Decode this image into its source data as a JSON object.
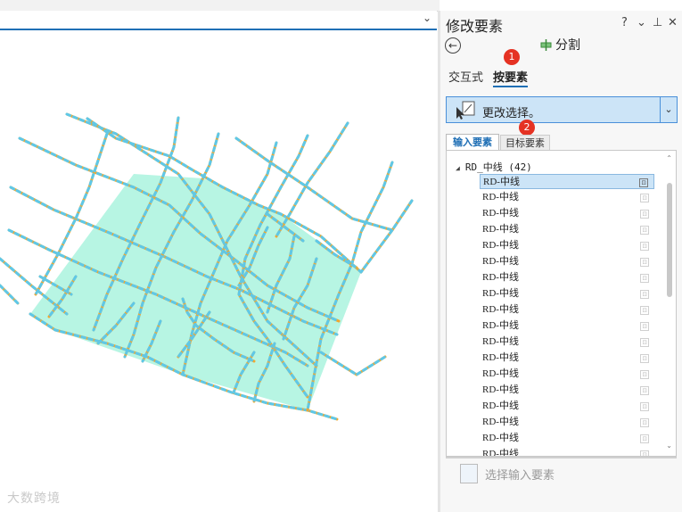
{
  "pane": {
    "title": "修改要素",
    "ctrl_help": "?",
    "ctrl_menu": "⌄",
    "ctrl_pin": "⊥",
    "ctrl_close": "✕",
    "split_label": "分割",
    "tab_interactive": "交互式",
    "tab_by_feature": "按要素",
    "marker1": "1",
    "marker2": "2",
    "select_mode": "更改选择。",
    "tab_input_features": "输入要素",
    "tab_target_features": "目标要素",
    "group_label": "RD_中线 (42)",
    "features": [
      "RD-中线",
      "RD-中线",
      "RD-中线",
      "RD-中线",
      "RD-中线",
      "RD-中线",
      "RD-中线",
      "RD-中线",
      "RD-中线",
      "RD-中线",
      "RD-中线",
      "RD-中线",
      "RD-中线",
      "RD-中线",
      "RD-中线",
      "RD-中线",
      "RD-中线",
      "RD-中线"
    ],
    "select_input_label": "选择输入要素"
  },
  "map": {
    "watermark": "大数跨境",
    "road_color": "#f0a830",
    "road_dash_color": "#5ec8e8",
    "polygon_fill": "#b7f5e3"
  }
}
